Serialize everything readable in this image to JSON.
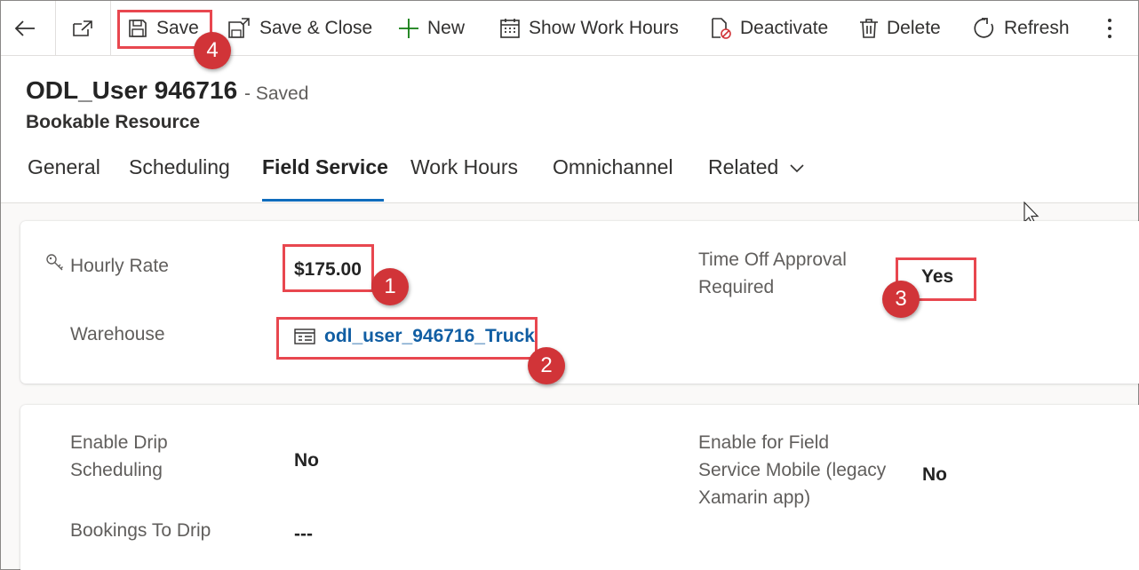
{
  "toolbar": {
    "save": "Save",
    "save_close": "Save & Close",
    "new": "New",
    "show_work_hours": "Show Work Hours",
    "deactivate": "Deactivate",
    "delete": "Delete",
    "refresh": "Refresh"
  },
  "record": {
    "title": "ODL_User 946716",
    "status": "- Saved",
    "entity": "Bookable Resource"
  },
  "tabs": [
    {
      "label": "General"
    },
    {
      "label": "Scheduling"
    },
    {
      "label": "Field Service",
      "active": true
    },
    {
      "label": "Work Hours"
    },
    {
      "label": "Omnichannel"
    },
    {
      "label": "Related"
    }
  ],
  "section1": {
    "hourly_rate_label": "Hourly Rate",
    "hourly_rate_value": "$175.00",
    "warehouse_label": "Warehouse",
    "warehouse_value": "odl_user_946716_Truck",
    "time_off_label_line1": "Time Off Approval",
    "time_off_label_line2": "Required",
    "time_off_value": "Yes"
  },
  "section2": {
    "drip_label_line1": "Enable Drip",
    "drip_label_line2": "Scheduling",
    "drip_value": "No",
    "bookings_label": "Bookings To Drip",
    "bookings_value": "---",
    "mobile_label_line1": "Enable for Field",
    "mobile_label_line2": "Service Mobile (legacy",
    "mobile_label_line3": "Xamarin app)",
    "mobile_value": "No"
  },
  "callouts": [
    "1",
    "2",
    "3",
    "4"
  ],
  "colors": {
    "accent": "#0f6cbd",
    "link": "#115ea3",
    "callout": "#d13438",
    "highlight_border": "#e8474f"
  }
}
